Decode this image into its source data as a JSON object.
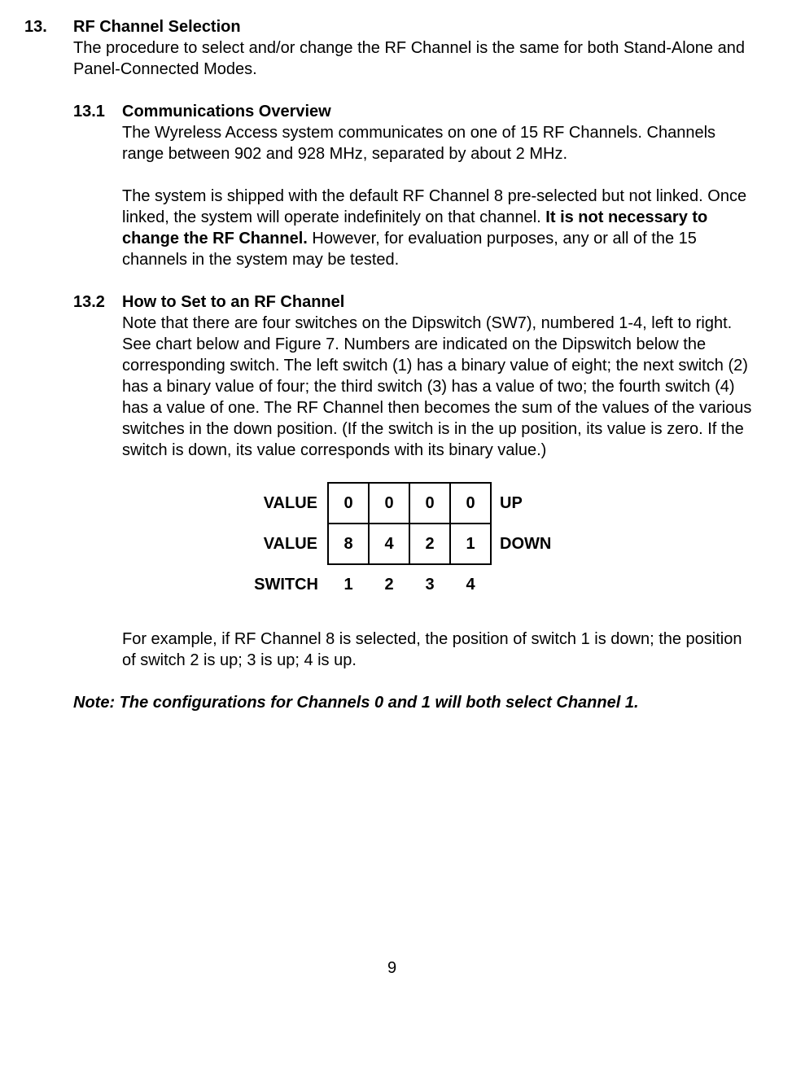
{
  "section": {
    "number": "13.",
    "title": "RF Channel Selection",
    "intro": "The procedure to select and/or change the RF Channel is the same for both Stand-Alone and Panel-Connected Modes."
  },
  "sub1": {
    "number": "13.1",
    "title": "Communications Overview",
    "p1": "The Wyreless Access system communicates on one of 15 RF Channels. Channels range between 902 and 928 MHz, separated by about 2 MHz.",
    "p2a": "The system is shipped with the default RF Channel 8 pre-selected but not linked.  Once linked, the system will operate indefinitely on that channel. ",
    "p2b": "It is not necessary to change the RF Channel.",
    "p2c": "  However, for evaluation purposes, any or all of the 15 channels in the system may be tested."
  },
  "sub2": {
    "number": "13.2",
    "title": "How to Set to an RF Channel",
    "p1": "Note that there are four switches on the Dipswitch (SW7), numbered 1-4, left to right. See chart below and Figure 7. Numbers are indicated on the Dipswitch below the corresponding switch. The left switch (1) has a binary value of eight; the next switch (2) has a binary value of four; the third switch (3) has a value of two; the fourth switch (4) has a value of one.  The RF Channel then becomes the sum of the values of the various switches in the down position.  (If the switch is in the up position, its value is zero. If the switch is down, its value corresponds with its binary value.)",
    "p2": "For example, if RF Channel 8 is selected, the position of switch 1 is down; the position of switch 2 is up; 3 is up; 4 is up."
  },
  "table": {
    "row1_label": "VALUE",
    "row1_vals": [
      "0",
      "0",
      "0",
      "0"
    ],
    "row1_suffix": "UP",
    "row2_label": "VALUE",
    "row2_vals": [
      "8",
      "4",
      "2",
      "1"
    ],
    "row2_suffix": "DOWN",
    "row3_label": "SWITCH",
    "row3_vals": [
      "1",
      "2",
      "3",
      "4"
    ]
  },
  "note": "Note:  The configurations for Channels 0 and 1 will both select Channel 1.",
  "page_number": "9",
  "chart_data": {
    "type": "table",
    "description": "Dipswitch binary value mapping",
    "columns": [
      "Switch 1",
      "Switch 2",
      "Switch 3",
      "Switch 4"
    ],
    "rows": [
      {
        "label": "VALUE (UP position)",
        "values": [
          0,
          0,
          0,
          0
        ]
      },
      {
        "label": "VALUE (DOWN position)",
        "values": [
          8,
          4,
          2,
          1
        ]
      },
      {
        "label": "SWITCH number",
        "values": [
          1,
          2,
          3,
          4
        ]
      }
    ]
  }
}
